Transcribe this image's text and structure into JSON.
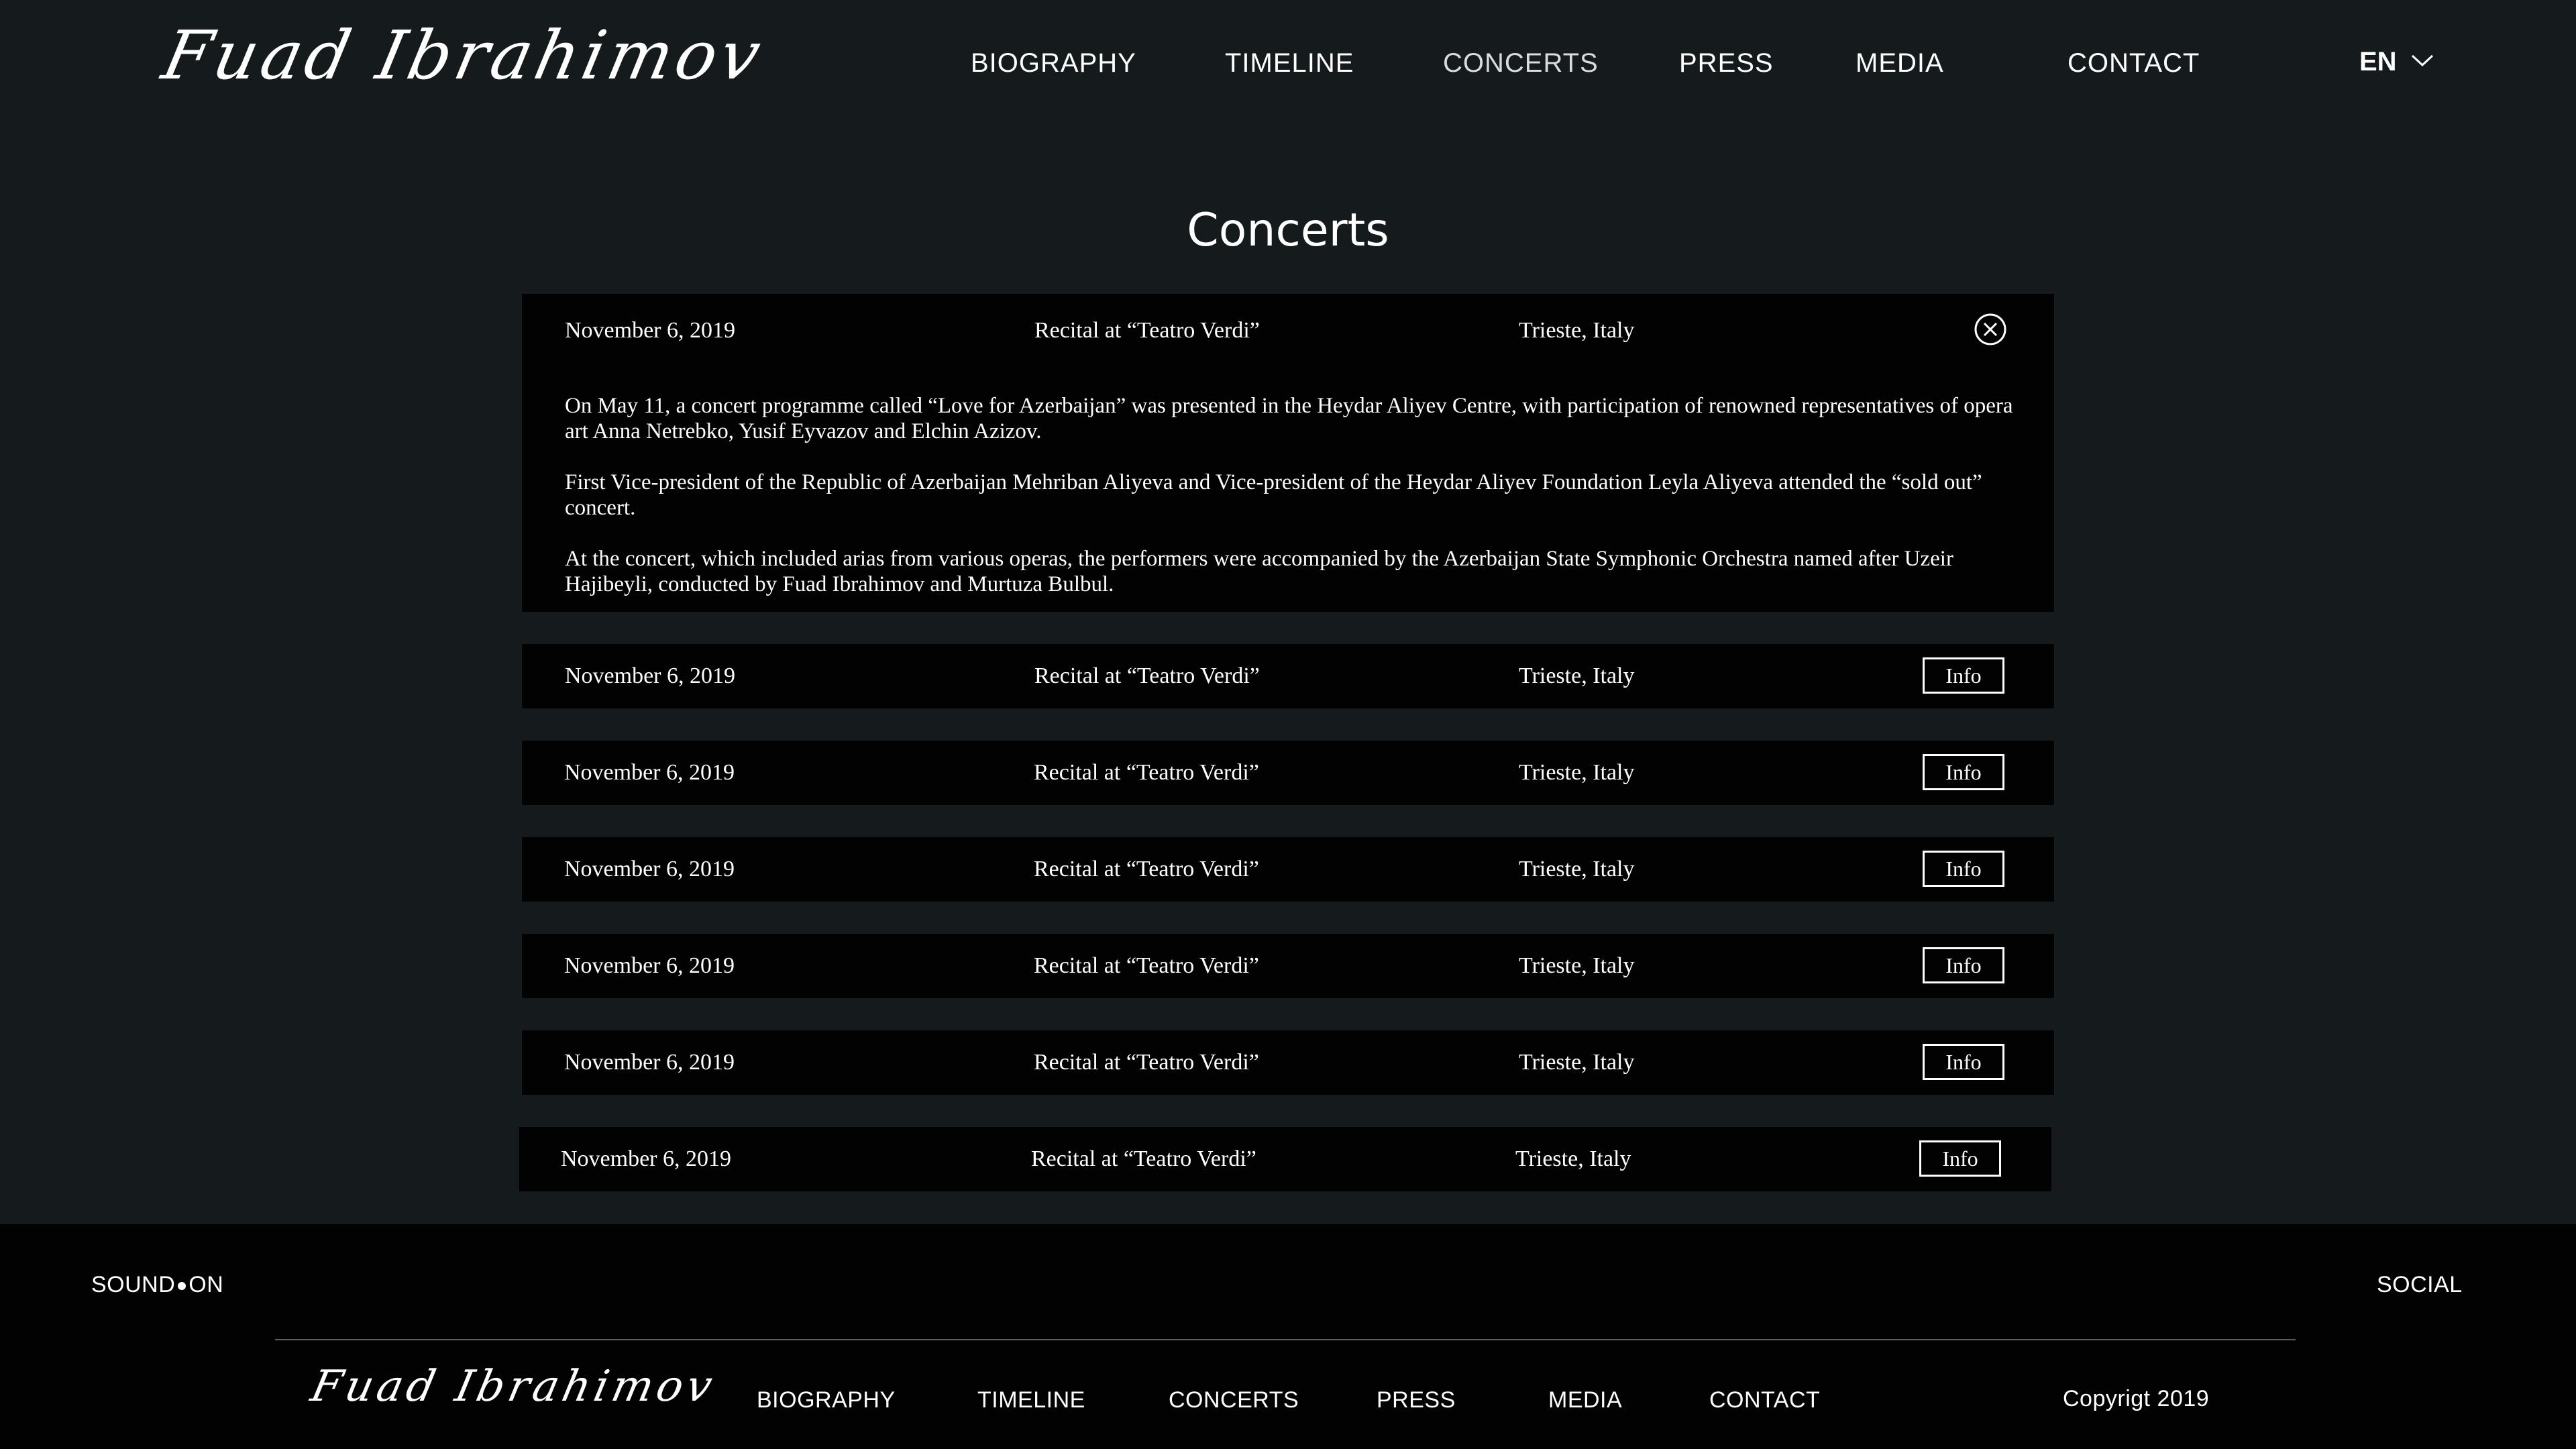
{
  "header": {
    "logo": "Fuad Ibrahimov",
    "nav": [
      "BIOGRAPHY",
      "TIMELINE",
      "CONCERTS",
      "PRESS",
      "MEDIA",
      "CONTACT"
    ],
    "active_nav": "CONCERTS",
    "language": "EN"
  },
  "page": {
    "title": "Concerts"
  },
  "concerts": [
    {
      "date": "November 6, 2019",
      "title": "Recital at “Teatro Verdi”",
      "location": "Trieste, Italy",
      "expanded": true,
      "paragraphs": [
        "On May 11, a concert programme called “Love for Azerbaijan” was presented in the Heydar Aliyev Centre, with participation of renowned representatives of opera art Anna Netrebko, Yusif Eyvazov and Elchin Azizov.",
        "First Vice-president of the Republic of Azerbaijan Mehriban Aliyeva and Vice-president of the Heydar Aliyev Foundation Leyla Aliyeva attended the “sold out” concert.",
        "At the concert, which included arias from various operas, the performers were accompanied by the Azerbaijan State Symphonic Orchestra named after Uzeir Hajibeyli, conducted by Fuad Ibrahimov and Murtuza Bulbul."
      ]
    },
    {
      "date": "November 6, 2019",
      "title": "Recital at “Teatro Verdi”",
      "location": "Trieste, Italy",
      "button": "Info"
    },
    {
      "date": "November 6, 2019",
      "title": "Recital at “Teatro Verdi”",
      "location": "Trieste, Italy",
      "button": "Info"
    },
    {
      "date": "November 6, 2019",
      "title": "Recital at “Teatro Verdi”",
      "location": "Trieste, Italy",
      "button": "Info"
    },
    {
      "date": "November 6, 2019",
      "title": "Recital at “Teatro Verdi”",
      "location": "Trieste, Italy",
      "button": "Info"
    },
    {
      "date": "November 6, 2019",
      "title": "Recital at “Teatro Verdi”",
      "location": "Trieste, Italy",
      "button": "Info"
    },
    {
      "date": "November 6, 2019",
      "title": "Recital at “Teatro Verdi”",
      "location": "Trieste, Italy",
      "button": "Info"
    }
  ],
  "footer": {
    "sound_left": "SOUND",
    "sound_right": "ON",
    "social": "SOCIAL",
    "logo": "Fuad Ibrahimov",
    "nav": [
      "BIOGRAPHY",
      "TIMELINE",
      "CONCERTS",
      "PRESS",
      "MEDIA",
      "CONTACT"
    ],
    "copyright": "Copyrigt 2019"
  },
  "colors": {
    "background": "#151a1c",
    "card": "#020202",
    "footer": "#020202",
    "text": "#ffffff"
  },
  "icons": {
    "close": "close-circle-icon",
    "language_dropdown": "chevron-down-icon"
  }
}
